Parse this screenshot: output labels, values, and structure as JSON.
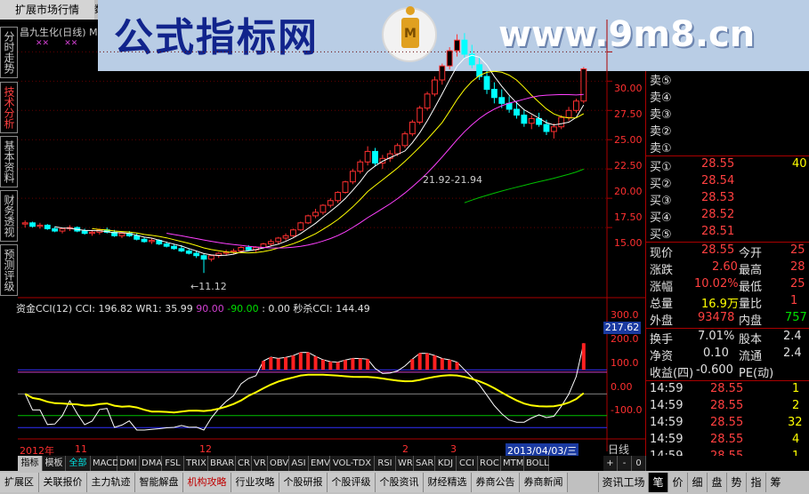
{
  "top_tab": {
    "label": "扩展市场行情",
    "label2": "数"
  },
  "banner": {
    "left_text": "公式指标网",
    "right_text": "www.9m8.cn",
    "logo_text": "wwww.9m8.cn"
  },
  "left_tabs": [
    {
      "label": "分时走势"
    },
    {
      "label": "技术分析"
    },
    {
      "label": "基本资料"
    },
    {
      "label": "财务透视"
    },
    {
      "label": "预测评级"
    }
  ],
  "chart": {
    "stock_title": "昌九生化(日线) M",
    "price_axis": [
      "30.00",
      "27.50",
      "25.00",
      "22.50",
      "20.00",
      "17.50",
      "15.00"
    ],
    "annotation_high": "21.92-21.94",
    "annotation_low": "11.12",
    "indicator_line": {
      "name": "资金CCI(12)",
      "cci_label": "CCI: 196.82",
      "wr1_label": "WR1: 35.99",
      "v1": "90.00",
      "v2": "-90.00",
      "v3": ": 0.00",
      "miaosha": "秒杀CCI: 144.49"
    },
    "indicator_axis": [
      "300.0",
      "200.0",
      "100.0",
      "0.00",
      "-100.0"
    ],
    "indicator_current": "217.62",
    "dates": {
      "d1": "2012年",
      "d2": "11",
      "d3": "12",
      "d4": "2",
      "d5": "3",
      "d6": "2013/04/03/三"
    },
    "period": "日线"
  },
  "chart_data": {
    "type": "candlestick",
    "title": "昌九生化(日线)",
    "ylim": [
      10,
      32
    ],
    "candles": [
      [
        15.3,
        15.6,
        15.0,
        15.4
      ],
      [
        15.4,
        15.5,
        15.0,
        15.1
      ],
      [
        15.1,
        15.4,
        14.9,
        15.2
      ],
      [
        15.2,
        15.3,
        14.8,
        14.9
      ],
      [
        14.9,
        15.1,
        14.6,
        14.7
      ],
      [
        14.7,
        15.0,
        14.5,
        14.9
      ],
      [
        14.9,
        15.2,
        14.7,
        15.0
      ],
      [
        15.0,
        15.1,
        14.6,
        14.7
      ],
      [
        14.7,
        14.9,
        14.4,
        14.5
      ],
      [
        14.5,
        14.8,
        14.3,
        14.6
      ],
      [
        14.6,
        14.9,
        14.4,
        14.8
      ],
      [
        14.8,
        15.0,
        14.5,
        14.6
      ],
      [
        14.6,
        14.8,
        14.2,
        14.3
      ],
      [
        14.3,
        14.6,
        14.1,
        14.5
      ],
      [
        14.5,
        14.7,
        14.2,
        14.3
      ],
      [
        14.3,
        14.5,
        13.9,
        14.0
      ],
      [
        14.0,
        14.2,
        13.7,
        13.8
      ],
      [
        13.8,
        14.1,
        13.6,
        13.9
      ],
      [
        13.9,
        14.0,
        13.5,
        13.6
      ],
      [
        13.6,
        13.8,
        13.3,
        13.4
      ],
      [
        13.4,
        13.6,
        13.1,
        13.2
      ],
      [
        13.2,
        13.5,
        12.9,
        13.0
      ],
      [
        13.0,
        13.2,
        12.7,
        12.8
      ],
      [
        12.8,
        13.0,
        12.4,
        12.6
      ],
      [
        12.6,
        12.8,
        11.12,
        12.3
      ],
      [
        12.3,
        12.7,
        12.1,
        12.6
      ],
      [
        12.6,
        12.9,
        12.4,
        12.8
      ],
      [
        12.8,
        13.1,
        12.6,
        12.9
      ],
      [
        12.9,
        13.2,
        12.7,
        13.0
      ],
      [
        13.0,
        13.4,
        12.8,
        13.3
      ],
      [
        13.3,
        13.5,
        13.0,
        13.1
      ],
      [
        13.1,
        13.4,
        12.9,
        13.3
      ],
      [
        13.3,
        13.7,
        13.2,
        13.6
      ],
      [
        13.6,
        14.0,
        13.4,
        13.8
      ],
      [
        13.8,
        14.2,
        13.6,
        14.1
      ],
      [
        14.1,
        14.5,
        13.9,
        14.3
      ],
      [
        14.3,
        14.9,
        14.2,
        14.8
      ],
      [
        14.8,
        15.5,
        14.7,
        15.4
      ],
      [
        15.4,
        16.1,
        15.3,
        16.0
      ],
      [
        16.0,
        16.6,
        15.8,
        16.3
      ],
      [
        16.3,
        17.0,
        16.1,
        16.9
      ],
      [
        16.9,
        17.5,
        16.7,
        17.3
      ],
      [
        17.3,
        18.1,
        17.1,
        18.0
      ],
      [
        18.0,
        19.0,
        17.9,
        18.9
      ],
      [
        18.9,
        20.0,
        18.7,
        19.8
      ],
      [
        19.8,
        20.8,
        19.6,
        20.6
      ],
      [
        20.6,
        21.94,
        20.3,
        21.5
      ],
      [
        21.5,
        21.8,
        20.2,
        20.5
      ],
      [
        20.5,
        21.2,
        20.0,
        20.9
      ],
      [
        20.9,
        21.6,
        20.6,
        21.3
      ],
      [
        21.3,
        22.2,
        21.1,
        22.0
      ],
      [
        22.0,
        23.2,
        21.8,
        23.0
      ],
      [
        23.0,
        24.2,
        22.8,
        24.0
      ],
      [
        24.0,
        25.4,
        23.8,
        25.2
      ],
      [
        25.2,
        26.6,
        25.0,
        26.4
      ],
      [
        26.4,
        27.9,
        26.2,
        27.6
      ],
      [
        27.6,
        29.0,
        27.2,
        28.8
      ],
      [
        28.8,
        30.4,
        28.5,
        30.1
      ],
      [
        30.1,
        31.5,
        29.6,
        31.0
      ],
      [
        31.0,
        31.6,
        29.4,
        29.8
      ],
      [
        29.8,
        30.6,
        28.6,
        28.9
      ],
      [
        28.9,
        29.6,
        27.6,
        27.9
      ],
      [
        27.9,
        28.4,
        26.4,
        26.8
      ],
      [
        26.8,
        27.4,
        25.6,
        26.1
      ],
      [
        26.1,
        26.8,
        25.2,
        25.6
      ],
      [
        25.6,
        26.2,
        24.8,
        25.1
      ],
      [
        25.1,
        25.8,
        24.3,
        24.6
      ],
      [
        24.6,
        25.1,
        23.6,
        23.9
      ],
      [
        23.9,
        24.6,
        23.4,
        24.3
      ],
      [
        24.3,
        24.8,
        23.6,
        23.8
      ],
      [
        23.8,
        24.2,
        22.9,
        23.2
      ],
      [
        23.2,
        23.9,
        22.6,
        23.6
      ],
      [
        23.6,
        24.6,
        23.4,
        24.4
      ],
      [
        24.4,
        25.3,
        24.1,
        25.0
      ],
      [
        25.0,
        26.0,
        24.8,
        25.8
      ],
      [
        25.8,
        28.7,
        25.6,
        28.55
      ]
    ],
    "last_price": 28.55
  },
  "quote": {
    "sell": [
      {
        "label": "卖⑤",
        "price": "",
        "vol": ""
      },
      {
        "label": "卖④",
        "price": "",
        "vol": ""
      },
      {
        "label": "卖③",
        "price": "",
        "vol": ""
      },
      {
        "label": "卖②",
        "price": "",
        "vol": ""
      },
      {
        "label": "卖①",
        "price": "",
        "vol": ""
      }
    ],
    "buy": [
      {
        "label": "买①",
        "price": "28.55",
        "vol": "40"
      },
      {
        "label": "买②",
        "price": "28.54",
        "vol": ""
      },
      {
        "label": "买③",
        "price": "28.53",
        "vol": ""
      },
      {
        "label": "买④",
        "price": "28.52",
        "vol": ""
      },
      {
        "label": "买⑤",
        "price": "28.51",
        "vol": ""
      }
    ],
    "stats": [
      {
        "k1": "现价",
        "v1": "28.55",
        "k2": "今开",
        "v2": "25"
      },
      {
        "k1": "涨跌",
        "v1": "2.60",
        "k2": "最高",
        "v2": "28"
      },
      {
        "k1": "涨幅",
        "v1": "10.02%",
        "k2": "最低",
        "v2": "25"
      },
      {
        "k1": "总量",
        "v1": "16.9万",
        "k2": "量比",
        "v2": "1"
      },
      {
        "k1": "外盘",
        "v1": "93478",
        "k2": "内盘",
        "v2": "757"
      }
    ],
    "stats2": [
      {
        "k1": "换手",
        "v1": "7.01%",
        "k2": "股本",
        "v2": "2.4"
      },
      {
        "k1": "净资",
        "v1": "0.10",
        "k2": "流通",
        "v2": "2.4"
      },
      {
        "k1": "收益(四)",
        "v1": "-0.600",
        "k2": "PE(动)",
        "v2": ""
      }
    ],
    "ticks": [
      {
        "time": "14:59",
        "price": "28.55",
        "vol": "1"
      },
      {
        "time": "14:59",
        "price": "28.55",
        "vol": "2"
      },
      {
        "time": "14:59",
        "price": "28.55",
        "vol": "32"
      },
      {
        "time": "14:59",
        "price": "28.55",
        "vol": "4"
      },
      {
        "time": "14:59",
        "price": "28.55",
        "vol": "1"
      },
      {
        "time": "14:59",
        "price": "28.55",
        "vol": "1"
      }
    ]
  },
  "toolbar1": {
    "items": [
      "指标",
      "模板",
      "全部",
      "MACD",
      "DMI",
      "DMA",
      "FSL",
      "TRIX",
      "BRAR",
      "CR",
      "VR",
      "OBV",
      "ASI",
      "EMV",
      "VOL-TDX",
      "RSI",
      "WR",
      "SAR",
      "KDJ",
      "CCI",
      "ROC",
      "MTM",
      "BOLL"
    ],
    "right": [
      "+",
      "-",
      "0"
    ]
  },
  "toolbar2": {
    "items": [
      "扩展区",
      "关联报价",
      "主力轨迹",
      "智能解盘",
      "机构攻略",
      "行业攻略",
      "个股研报",
      "个股评级",
      "个股资讯",
      "财经精选",
      "券商公告",
      "券商新闻"
    ],
    "right": [
      "资讯工场",
      "笔",
      "价",
      "细",
      "盘",
      "势",
      "指",
      "筹"
    ]
  }
}
